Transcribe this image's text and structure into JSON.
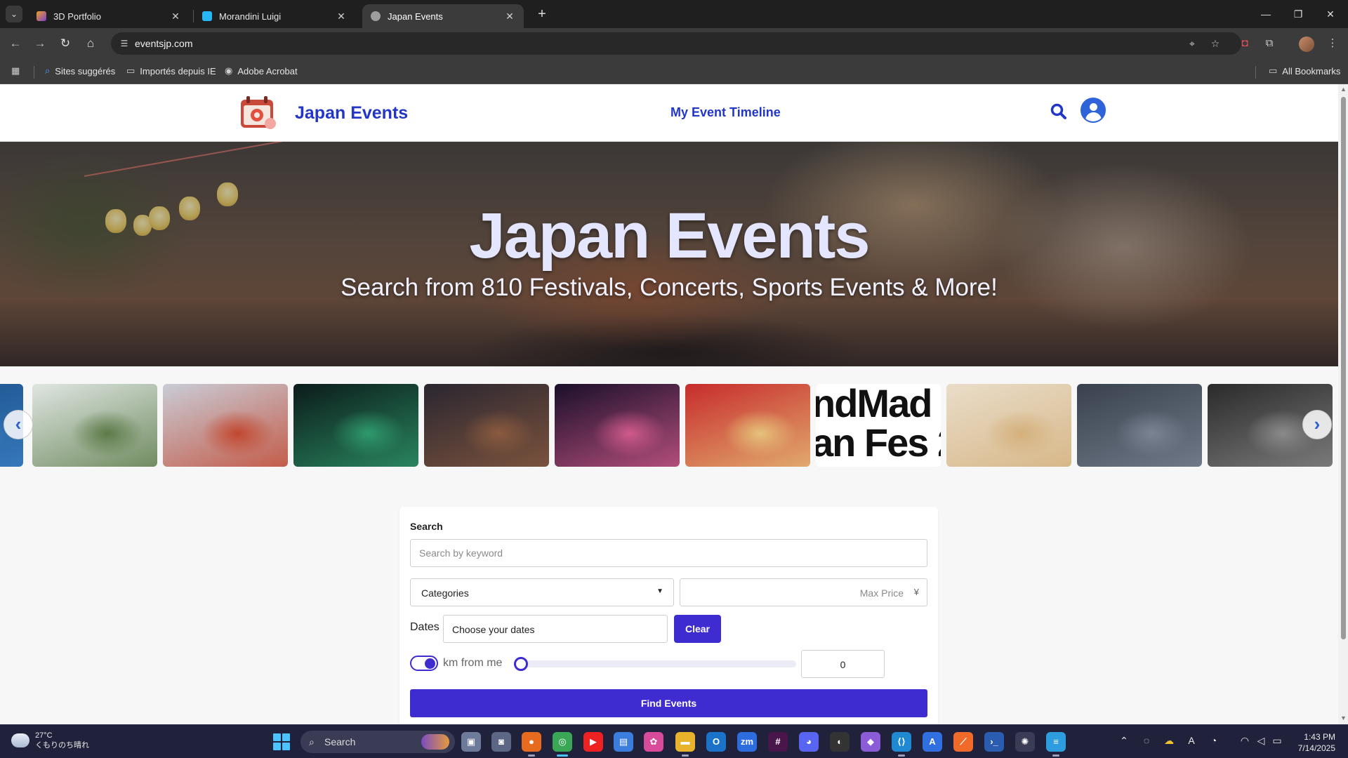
{
  "browser": {
    "tabs": [
      {
        "title": "3D Portfolio",
        "active": false,
        "color": "#f0a020"
      },
      {
        "title": "Morandini Luigi",
        "active": false,
        "color": "#29b6f6"
      },
      {
        "title": "Japan Events",
        "active": true,
        "color": "#9e9e9e"
      }
    ],
    "url": "eventsjp.com",
    "bookmarks": [
      "Sites suggérés",
      "Importés depuis IE",
      "Adobe Acrobat"
    ],
    "all_bookmarks_label": "All Bookmarks"
  },
  "site": {
    "brand": "Japan Events",
    "nav_link": "My Event Timeline",
    "accent_color": "#2236c8",
    "button_color": "#3f2cd1"
  },
  "hero": {
    "title": "Japan Events",
    "subtitle": "Search from 810 Festivals, Concerts, Sports Events & More!"
  },
  "carousel": {
    "items": [
      {
        "desc": "partial",
        "colors": [
          "#1b4f87",
          "#3b80c6"
        ]
      },
      {
        "desc": "white arches garden",
        "colors": [
          "#dfe6e2",
          "#5c7a48"
        ]
      },
      {
        "desc": "festival stage lanterns",
        "colors": [
          "#c9ccd6",
          "#c2472f"
        ]
      },
      {
        "desc": "digital light art",
        "colors": [
          "#0b1b1a",
          "#2f9a6c"
        ]
      },
      {
        "desc": "country band",
        "colors": [
          "#2a2630",
          "#8a5b3f"
        ]
      },
      {
        "desc": "fireworks",
        "colors": [
          "#1a0f2a",
          "#d05a8a"
        ]
      },
      {
        "desc": "taiko drum",
        "colors": [
          "#c72c2c",
          "#e6c27a"
        ]
      },
      {
        "desc": "text banner",
        "text": [
          "ndMad",
          "an Fes 2"
        ]
      },
      {
        "desc": "cookies",
        "colors": [
          "#e9ddc9",
          "#d4b07c"
        ]
      },
      {
        "desc": "crowd",
        "colors": [
          "#39414d",
          "#7a8493"
        ]
      },
      {
        "desc": "band photo",
        "colors": [
          "#2a2a2a",
          "#8a8a8a"
        ]
      }
    ]
  },
  "search_form": {
    "label": "Search",
    "keyword_placeholder": "Search by keyword",
    "category_value": "Categories",
    "max_price_placeholder": "Max Price",
    "currency": "¥",
    "dates_label": "Dates",
    "dates_value": "Choose your dates",
    "clear_label": "Clear",
    "km_label": "km from me",
    "km_value": "0",
    "distance_toggle_on": true,
    "find_label": "Find Events"
  },
  "taskbar": {
    "temp": "27°C",
    "weather": "くもりのち晴れ",
    "search": "Search",
    "time": "1:43 PM",
    "date": "7/14/2025"
  }
}
